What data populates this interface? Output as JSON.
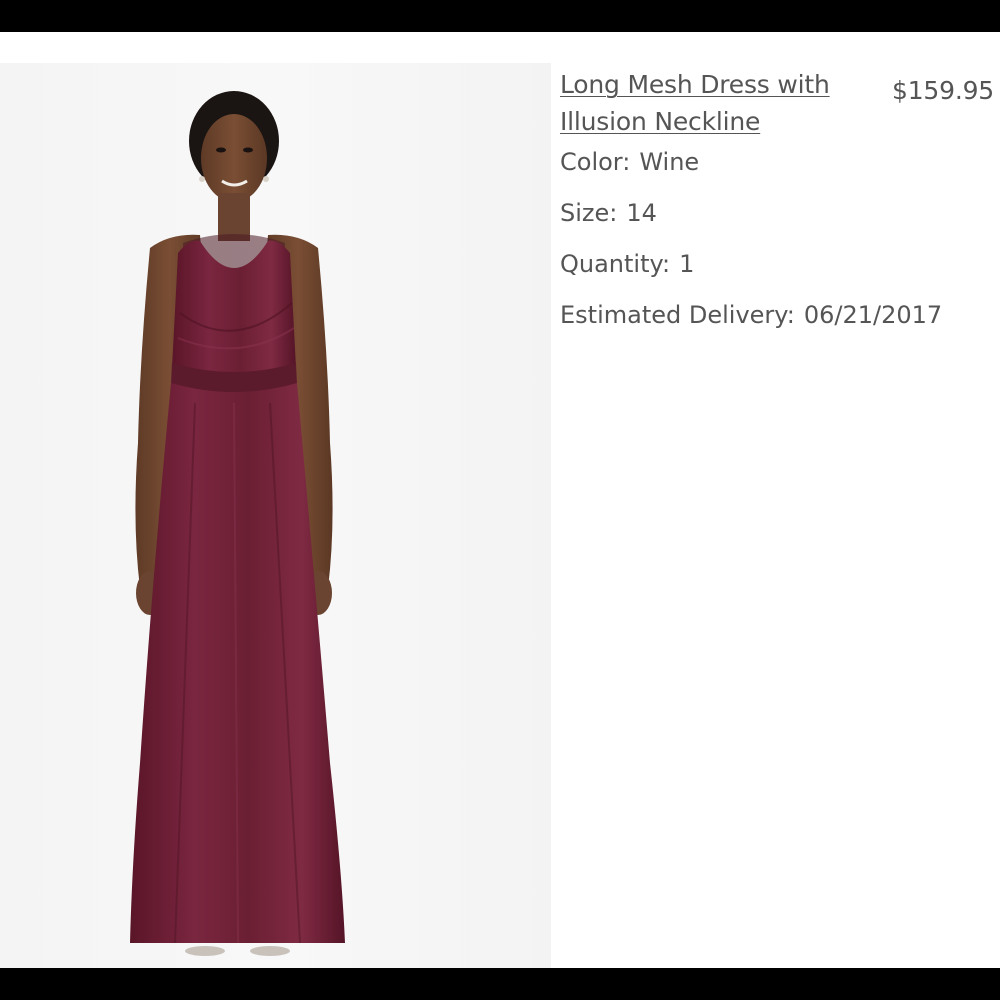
{
  "product": {
    "title": "Long Mesh Dress with Illusion Neckline",
    "price": "$159.95",
    "image_alt": "Model wearing a long wine mesh dress with illusion neckline"
  },
  "attributes": {
    "color": {
      "label": "Color:",
      "value": "Wine"
    },
    "size": {
      "label": "Size:",
      "value": "14"
    },
    "quantity": {
      "label": "Quantity:",
      "value": "1"
    },
    "delivery": {
      "label": "Estimated Delivery:",
      "value": "06/21/2017"
    }
  },
  "colors": {
    "dress": "#6b1f33",
    "text": "#555555",
    "bars": "#000000"
  }
}
